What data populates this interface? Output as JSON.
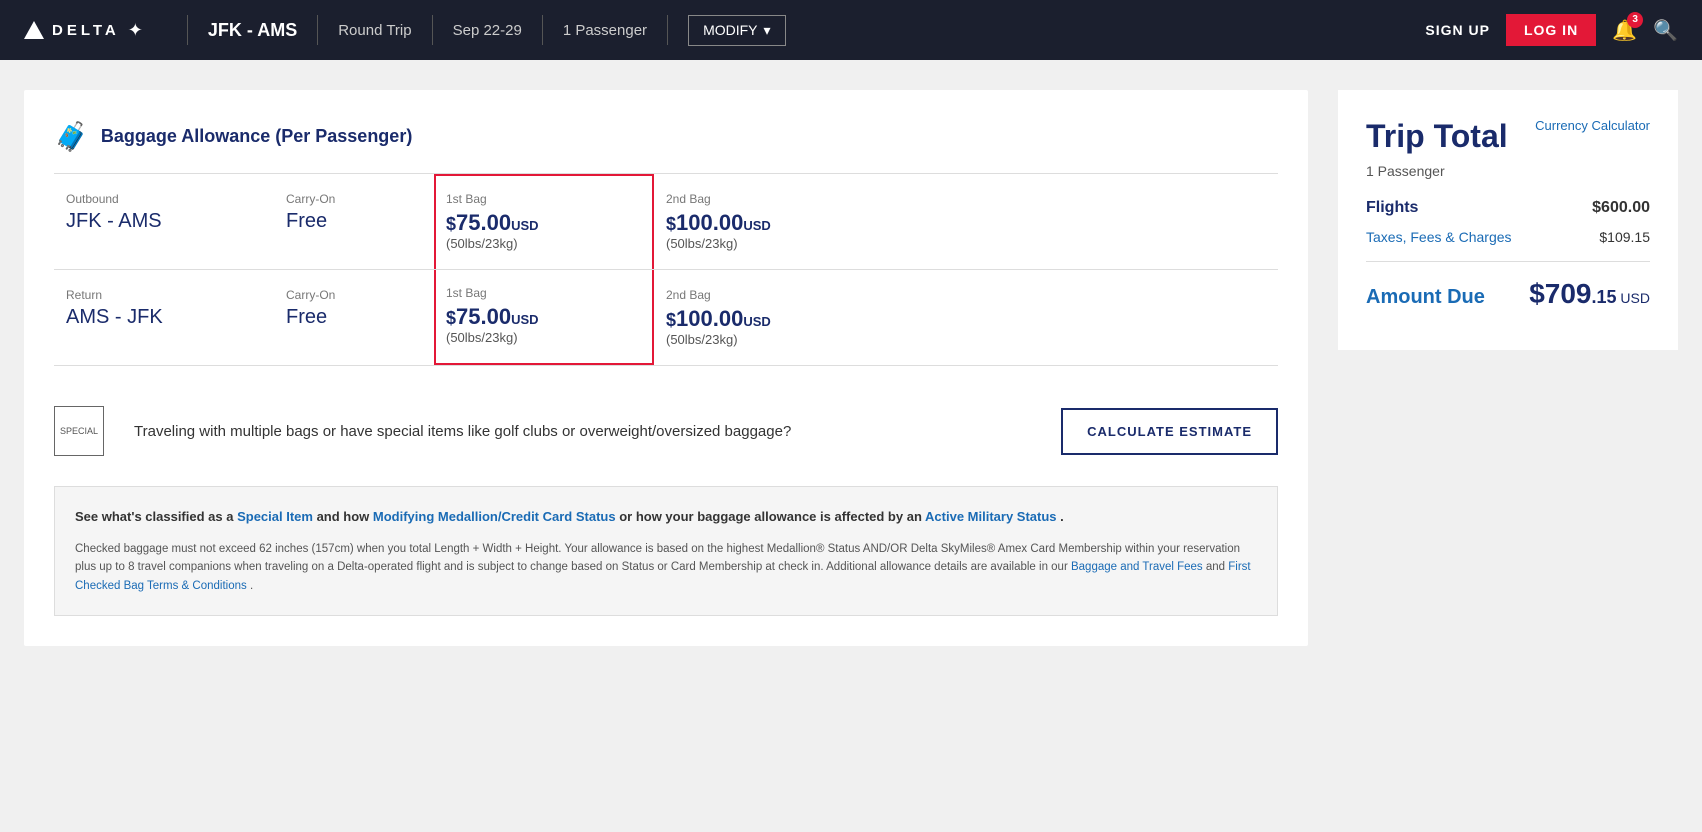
{
  "header": {
    "logo_text": "DELTA",
    "route": "JFK - AMS",
    "trip_type": "Round Trip",
    "dates": "Sep 22-29",
    "passengers": "1 Passenger",
    "modify_label": "MODIFY",
    "signup_label": "SIGN UP",
    "login_label": "LOG IN",
    "notification_count": "3"
  },
  "baggage": {
    "title": "Baggage Allowance (Per Passenger)",
    "outbound_label": "Outbound",
    "outbound_route": "JFK - AMS",
    "return_label": "Return",
    "return_route": "AMS - JFK",
    "carry_on_label": "Carry-On",
    "carry_on_value": "Free",
    "first_bag_label": "1st Bag",
    "first_bag_price_symbol": "$",
    "first_bag_price_main": "75.00",
    "first_bag_price_usd": "USD",
    "first_bag_weight": "(50lbs/23kg)",
    "second_bag_label": "2nd Bag",
    "second_bag_price_symbol": "$",
    "second_bag_price_main": "100.00",
    "second_bag_price_usd": "USD",
    "second_bag_weight": "(50lbs/23kg)"
  },
  "calculate": {
    "special_label": "SPECIAL",
    "text": "Traveling with multiple bags or have special items like golf clubs or overweight/oversized baggage?",
    "button_label": "CALCULATE ESTIMATE"
  },
  "info": {
    "top_text_before": "See what's classified as a ",
    "special_item_link": "Special Item",
    "top_text_middle": " and how ",
    "medallion_link": "Modifying Medallion/Credit Card Status",
    "top_text_after": " or how your baggage allowance is affected by an ",
    "military_link": "Active Military Status",
    "top_text_period": " .",
    "body_text": "Checked baggage must not exceed 62 inches (157cm) when you total Length + Width + Height. Your allowance is based on the highest Medallion® Status AND/OR Delta SkyMiles® Amex Card Membership within your reservation plus up to 8 travel companions when traveling on a Delta-operated flight and is subject to change based on Status or Card Membership at check in. Additional allowance details are available in our ",
    "baggage_fees_link": "Baggage and Travel Fees",
    "body_text_middle": " and ",
    "first_bag_terms_link": "First Checked Bag Terms & Conditions",
    "body_text_end": " ."
  },
  "trip_total": {
    "title": "Trip Total",
    "currency_calc_label": "Currency Calculator",
    "passengers_label": "1 Passenger",
    "flights_label": "Flights",
    "flights_value": "$600.00",
    "fees_label": "Taxes, Fees & Charges",
    "fees_value": "$109.15",
    "amount_due_label": "Amount Due",
    "amount_due_main": "$709",
    "amount_due_cents": ".15",
    "amount_due_currency": " USD"
  }
}
